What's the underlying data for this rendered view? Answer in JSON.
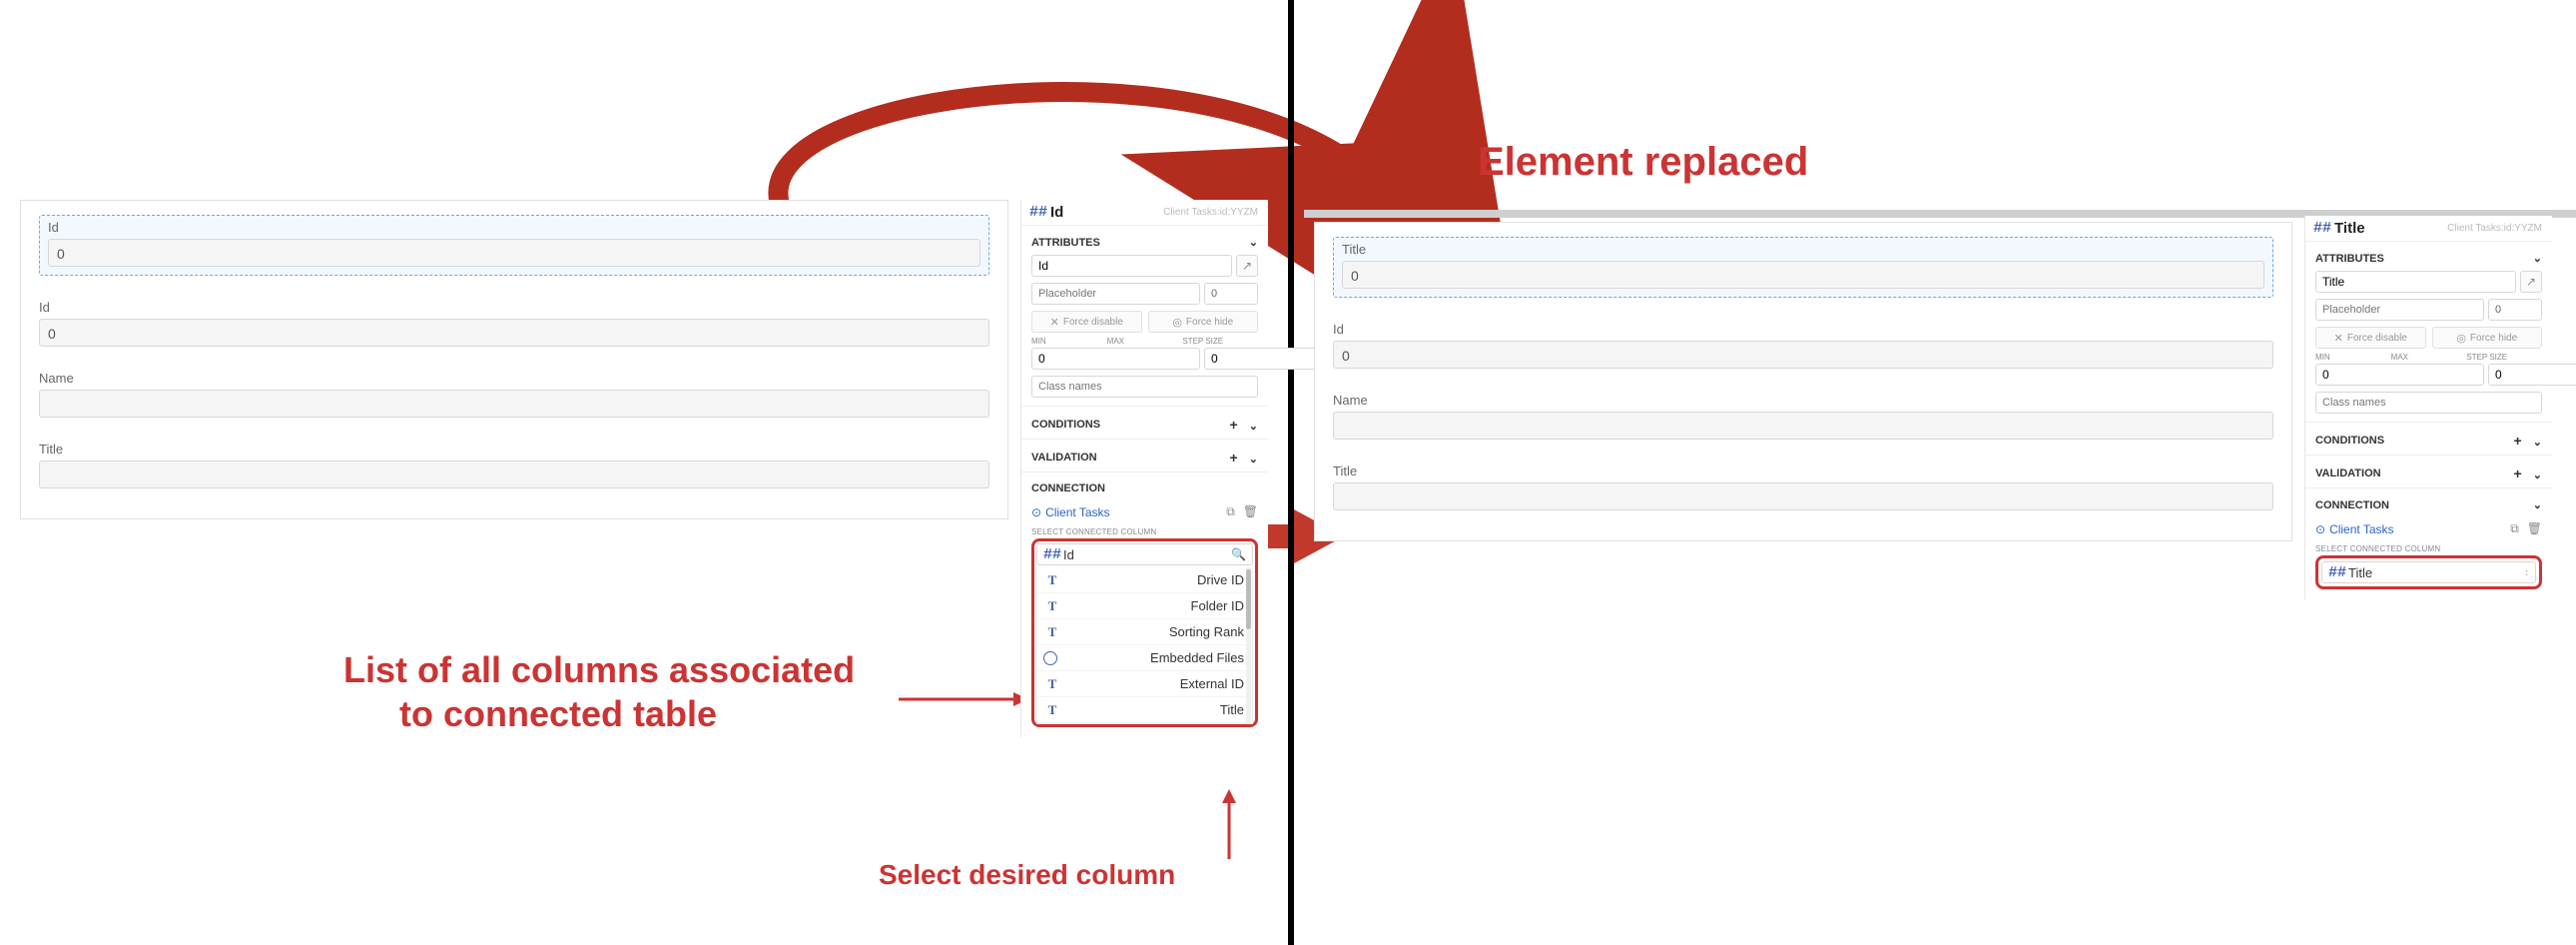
{
  "annotations": {
    "element_replaced": "Element replaced",
    "list_caption_l1": "List of all columns associated",
    "list_caption_l2": "to connected table",
    "select_caption": "Select desired column"
  },
  "left": {
    "canvas": {
      "fields": [
        {
          "label": "Id",
          "value": "0",
          "selected": true
        },
        {
          "label": "Id",
          "value": "0",
          "selected": false
        },
        {
          "label": "Name",
          "value": "",
          "selected": false
        },
        {
          "label": "Title",
          "value": "",
          "selected": false
        }
      ]
    },
    "props": {
      "header_column": "Id",
      "header_meta": "Client Tasks:id:YYZM",
      "attributes": {
        "title": "ATTRIBUTES",
        "name_value": "Id",
        "placeholder_label": "Placeholder",
        "placeholder_default": "0",
        "force_disable": "Force disable",
        "force_hide": "Force hide",
        "min_label": "MIN",
        "max_label": "MAX",
        "step_label": "STEP SIZE",
        "min": "0",
        "max": "0",
        "step": "0",
        "class_names_ph": "Class names"
      },
      "conditions_title": "CONDITIONS",
      "validation_title": "VALIDATION",
      "connection": {
        "title": "CONNECTION",
        "table": "Client Tasks",
        "select_label": "SELECT CONNECTED COLUMN",
        "current": "Id",
        "columns": [
          {
            "type": "T",
            "name": "Drive ID"
          },
          {
            "type": "T",
            "name": "Folder ID"
          },
          {
            "type": "T",
            "name": "Sorting Rank"
          },
          {
            "type": "circle",
            "name": "Embedded Files"
          },
          {
            "type": "T",
            "name": "External ID"
          },
          {
            "type": "T",
            "name": "Title"
          }
        ]
      }
    }
  },
  "right": {
    "canvas": {
      "fields": [
        {
          "label": "Title",
          "value": "0",
          "selected": true
        },
        {
          "label": "Id",
          "value": "0",
          "selected": false
        },
        {
          "label": "Name",
          "value": "",
          "selected": false
        },
        {
          "label": "Title",
          "value": "",
          "selected": false
        }
      ]
    },
    "props": {
      "header_column": "Title",
      "header_meta": "Client Tasks:id:YYZM",
      "attributes": {
        "title": "ATTRIBUTES",
        "name_value": "Title",
        "placeholder_label": "Placeholder",
        "placeholder_default": "0",
        "force_disable": "Force disable",
        "force_hide": "Force hide",
        "min_label": "MIN",
        "max_label": "MAX",
        "step_label": "STEP SIZE",
        "min": "0",
        "max": "0",
        "step": "0",
        "class_names_ph": "Class names"
      },
      "conditions_title": "CONDITIONS",
      "validation_title": "VALIDATION",
      "connection": {
        "title": "CONNECTION",
        "table": "Client Tasks",
        "select_label": "SELECT CONNECTED COLUMN",
        "current": "Title"
      }
    }
  }
}
